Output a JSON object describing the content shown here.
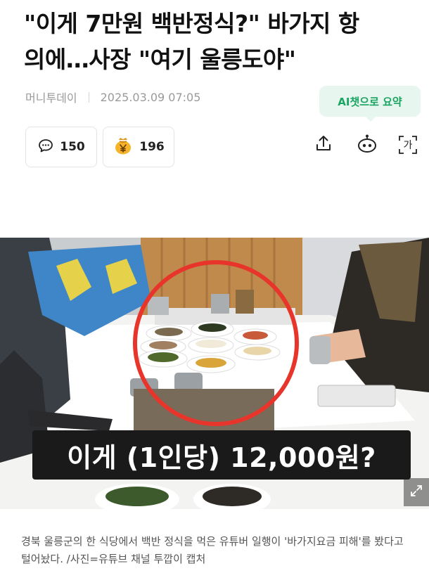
{
  "article": {
    "headline_line1": "\"이게 7만원 백반정식?\" 바가지 항",
    "headline_line2": "의에…사장 \"여기 울릉도야\"",
    "source": "머니투데이",
    "datetime": "2025.03.09 07:05"
  },
  "ai_summary": {
    "label": "AI챗으로 요약",
    "color": "#1aa562"
  },
  "stats": {
    "comments": {
      "icon": "speech-bubble-icon",
      "count": "150"
    },
    "reactions": {
      "icon": "money-bag-icon",
      "count": "196"
    }
  },
  "toolbar": [
    {
      "icon": "share-icon"
    },
    {
      "icon": "ai-bot-icon"
    },
    {
      "icon": "font-size-icon",
      "glyph": "가"
    }
  ],
  "photo": {
    "overlay_text": "이게 (1인당) 12,000원?",
    "highlight_color": "#e8352b",
    "expand_icon": "expand-icon"
  },
  "caption": "경북 울릉군의 한 식당에서 백반 정식을 먹은 유튜버 일행이 '바가지요금 피해'를 봤다고 털어놨다. /사진=유튜브 채널 투깝이 캡처"
}
